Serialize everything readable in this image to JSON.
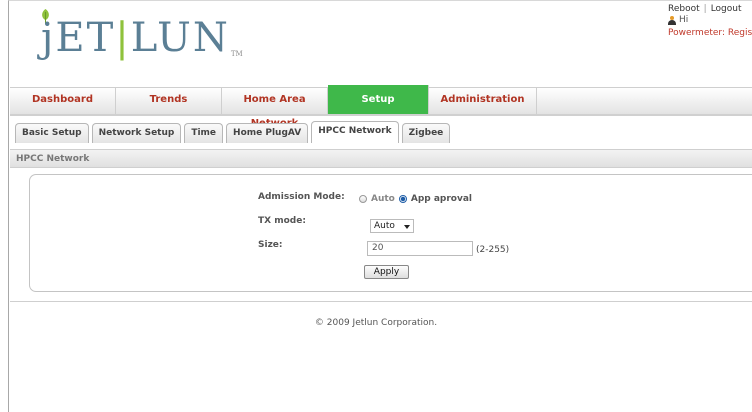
{
  "brand": {
    "logo_left": "jET",
    "logo_sep": "|",
    "logo_right": "LUN",
    "logo_tm": "TM"
  },
  "header": {
    "reboot_label": "Reboot",
    "pipe": "|",
    "logout_label": "Logout",
    "greeting": "Hi",
    "powermeter_text": "Powermeter: Register"
  },
  "nav": {
    "items": [
      {
        "label": "Dashboard"
      },
      {
        "label": "Trends"
      },
      {
        "label": "Home Area Network"
      },
      {
        "label": "Setup"
      },
      {
        "label": "Administration"
      }
    ]
  },
  "subtabs": {
    "items": [
      {
        "label": "Basic Setup"
      },
      {
        "label": "Network Setup"
      },
      {
        "label": "Time"
      },
      {
        "label": "Home PlugAV"
      },
      {
        "label": "HPCC Network"
      },
      {
        "label": "Zigbee"
      }
    ]
  },
  "panel": {
    "title": "HPCC Network"
  },
  "form": {
    "admission_label": "Admission Mode:",
    "admission_options": [
      "Auto",
      "App aproval"
    ],
    "admission_selected": "App aproval",
    "tx_label": "TX mode:",
    "tx_value": "Auto",
    "size_label": "Size:",
    "size_value": "20",
    "size_range": "(2-255)",
    "apply_label": "Apply"
  },
  "footer": {
    "text": "© 2009 Jetlun Corporation."
  },
  "colors": {
    "active_tab": "#3fb84a",
    "nav_text": "#b13423",
    "logo_blue": "#5b7f95",
    "logo_green": "#8fc23c",
    "powermeter": "#c0392b"
  },
  "icons": {
    "logo_leaf": "leaf-icon",
    "user": "user-icon",
    "select_arrow": "chevron-down-icon"
  }
}
